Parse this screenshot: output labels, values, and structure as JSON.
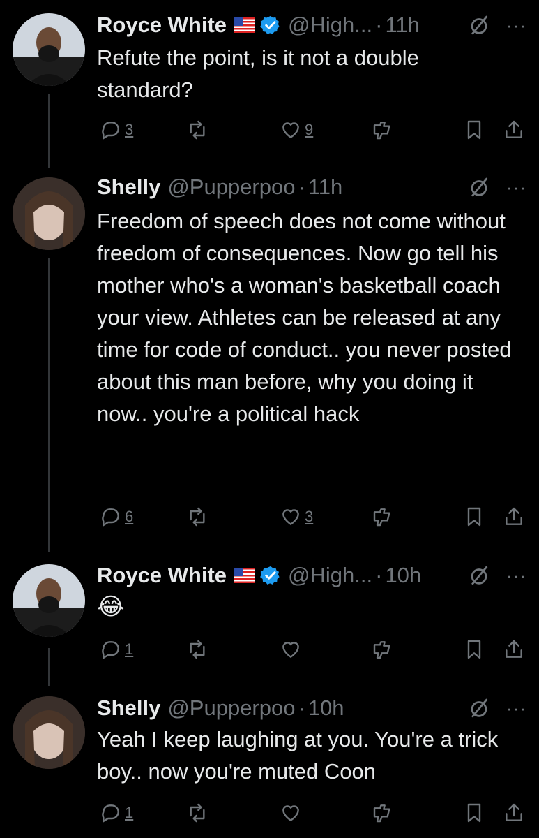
{
  "tweets": [
    {
      "name": "Royce White",
      "has_flag": true,
      "verified": true,
      "handle": "@High...",
      "sep": "·",
      "time": "11h",
      "text": "Refute the point, is it not a double standard?",
      "replies": "3",
      "retweets": "",
      "likes": "9"
    },
    {
      "name": "Shelly",
      "has_flag": false,
      "verified": false,
      "handle": "@Pupperpoo",
      "sep": "·",
      "time": "11h",
      "text": "Freedom of speech does not come without freedom of consequences. Now go tell his mother who's a woman's basketball coach your view. Athletes can be released at any time for code of conduct.. you never posted about this man before, why you doing it now.. you're a political hack",
      "replies": "6",
      "retweets": "",
      "likes": "3"
    },
    {
      "name": "Royce White",
      "has_flag": true,
      "verified": true,
      "handle": "@High...",
      "sep": "·",
      "time": "10h",
      "text": "😂",
      "replies": "1",
      "retweets": "",
      "likes": ""
    },
    {
      "name": "Shelly",
      "has_flag": false,
      "verified": false,
      "handle": "@Pupperpoo",
      "sep": "·",
      "time": "10h",
      "text": "Yeah I keep laughing at you. You're a trick boy.. now you're muted Coon",
      "replies": "1",
      "retweets": "",
      "likes": ""
    }
  ],
  "icons": {
    "reply": "reply-icon",
    "retweet": "retweet-icon",
    "like": "heart-icon",
    "views": "views-icon",
    "bookmark": "bookmark-icon",
    "share": "share-icon",
    "grok": "grok-icon",
    "more": "more-icon"
  },
  "more_glyph": "···",
  "colors": {
    "background": "#000000",
    "text": "#e7e9ea",
    "muted": "#71767b",
    "verified": "#1d9bf0",
    "line": "#333639"
  }
}
